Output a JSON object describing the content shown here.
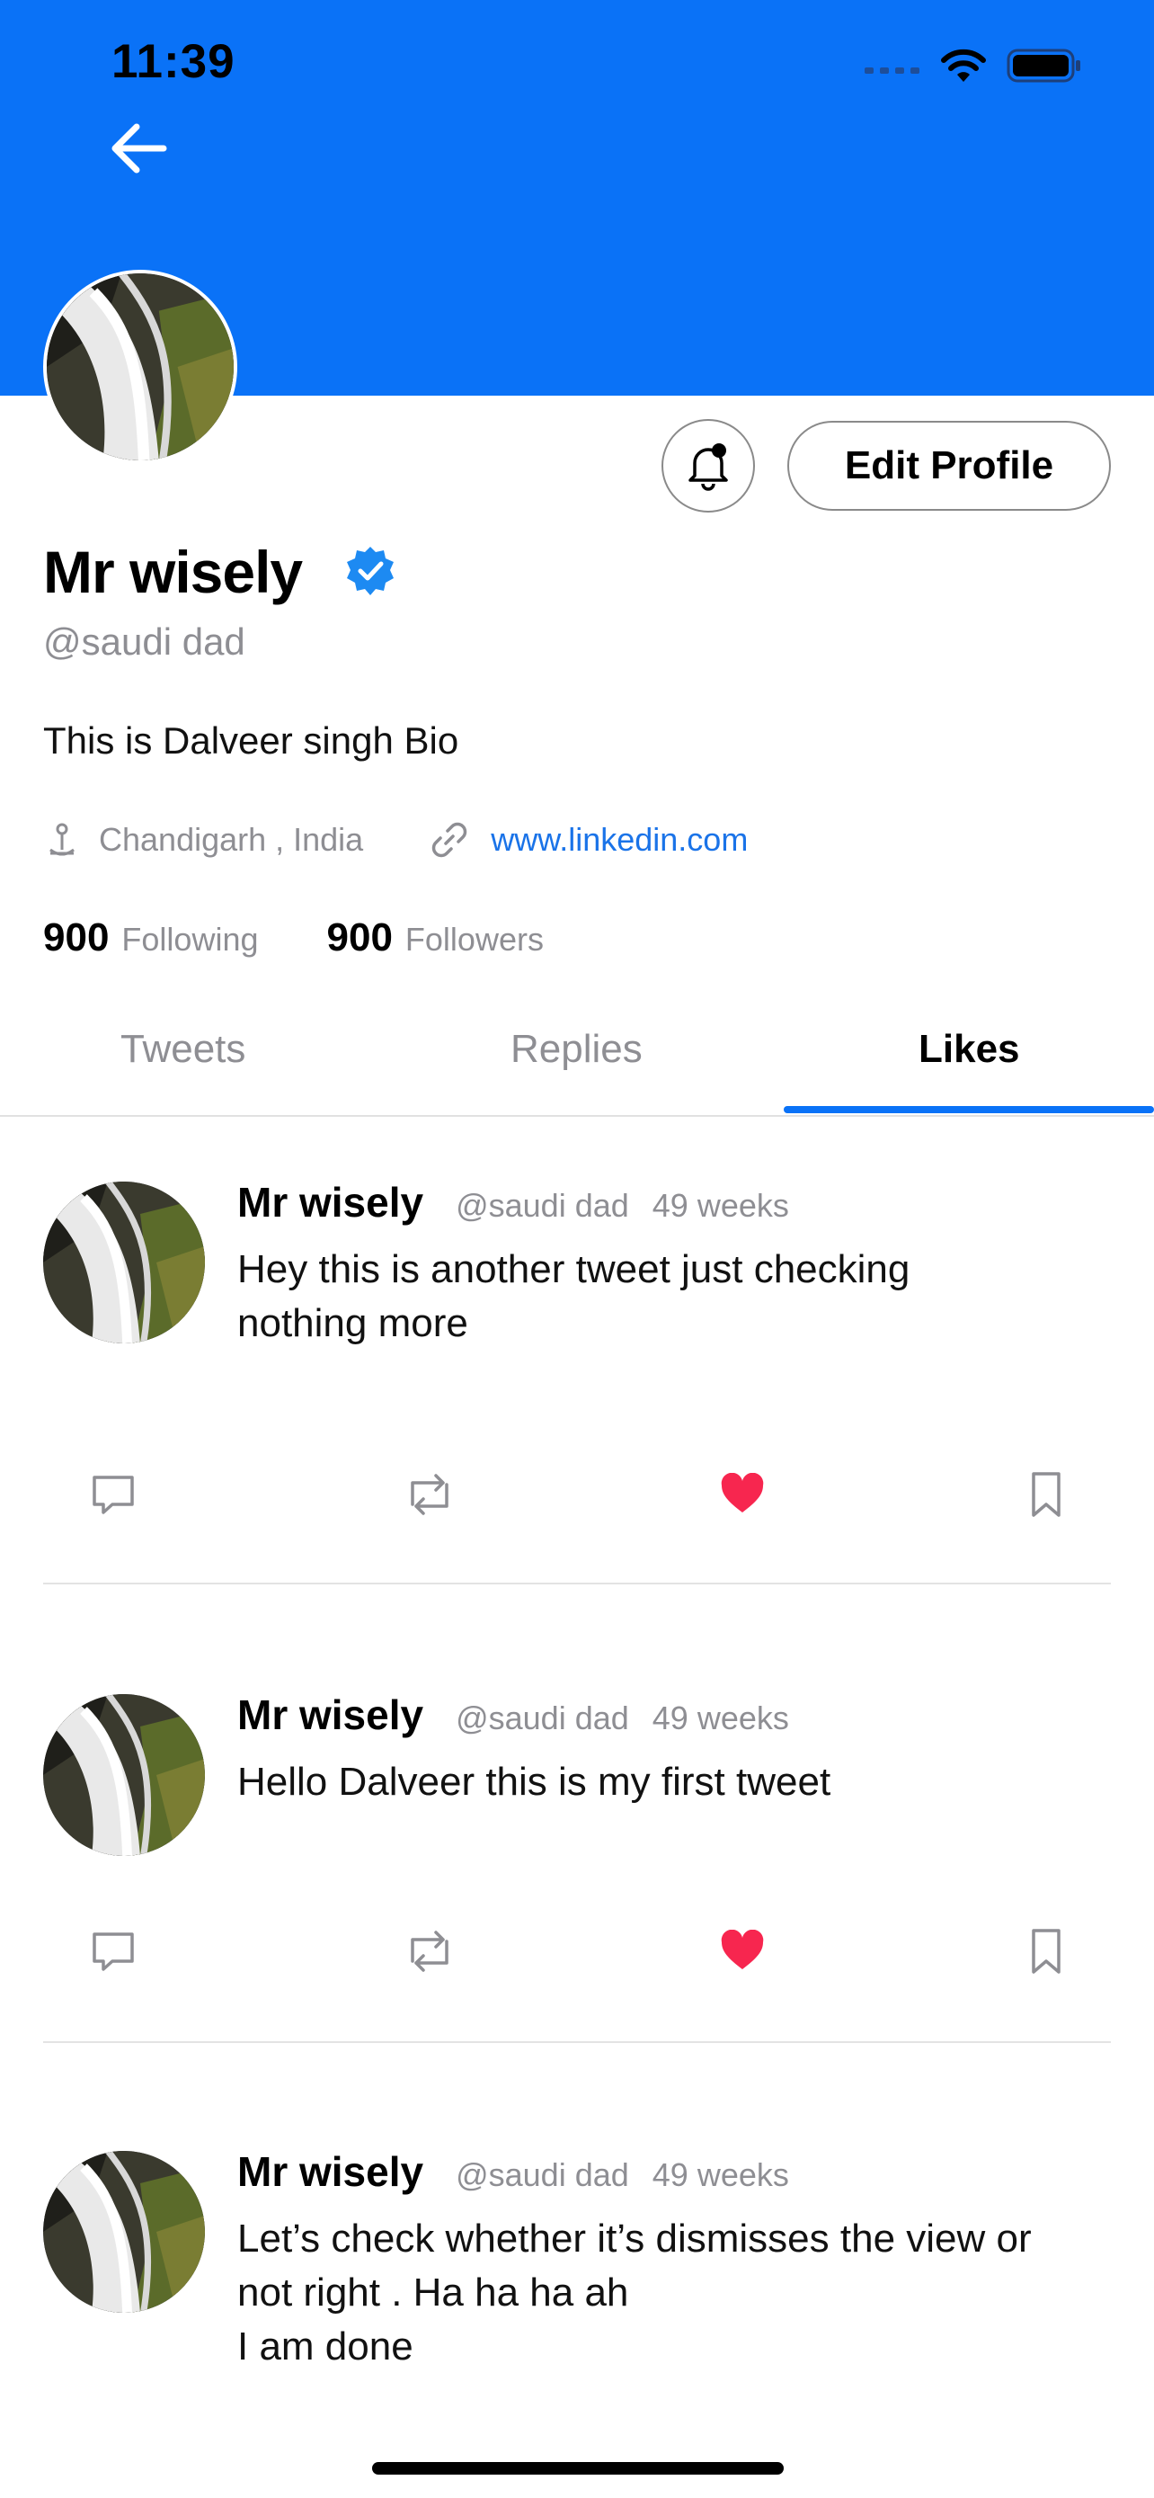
{
  "status_bar": {
    "time": "11:39"
  },
  "colors": {
    "accent": "#0a72f7",
    "like": "#f7264f",
    "link": "#1a73e8",
    "muted": "#8e8e93"
  },
  "profile": {
    "name": "Mr wisely",
    "handle": "@saudi dad",
    "bio": "This is Dalveer singh Bio",
    "location": "Chandigarh , India",
    "website": "www.linkedin.com",
    "following_count": "900",
    "following_label": "Following",
    "followers_count": "900",
    "followers_label": "Followers",
    "edit_button_label": "Edit Profile"
  },
  "tabs": [
    {
      "label": "Tweets",
      "active": false
    },
    {
      "label": "Replies",
      "active": false
    },
    {
      "label": "Likes",
      "active": true
    }
  ],
  "tweets": [
    {
      "name": "Mr wisely",
      "handle": "@saudi dad",
      "time": "49 weeks",
      "text": "Hey this is another tweet just checking\nnothing more",
      "liked": true
    },
    {
      "name": "Mr wisely",
      "handle": "@saudi dad",
      "time": "49 weeks",
      "text": "Hello Dalveer this is my first tweet",
      "liked": true
    },
    {
      "name": "Mr wisely",
      "handle": "@saudi dad",
      "time": "49 weeks",
      "text": "Let’s check whether it’s dismisses the view or\nnot right . Ha ha ha ah\nI am done",
      "liked": true
    }
  ],
  "icons": [
    "back-arrow-icon",
    "bell-icon",
    "verified-badge-icon",
    "location-pin-icon",
    "link-icon",
    "comment-icon",
    "retweet-icon",
    "heart-icon",
    "bookmark-icon",
    "signal-icon",
    "wifi-icon",
    "battery-icon"
  ]
}
